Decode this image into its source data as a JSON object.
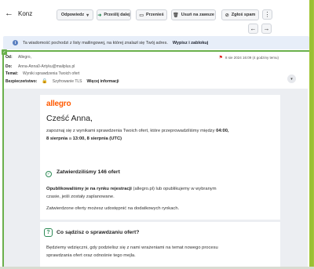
{
  "toolbar": {
    "back_label": "Konz",
    "reply_label": "Odpowiedz",
    "forward_label": "Prześlij dalej",
    "print_label": "Przenieś",
    "delete_label": "Usuń na zawsze",
    "report_label": "Zgłoś spam"
  },
  "notice": {
    "text": "Ta wiadomość pochodzi z listy mailingowej, na której znalazł się Twój adres.",
    "link": "Wypisz i zablokuj"
  },
  "header": {
    "from_key": "Od:",
    "from_val": "Allegro,",
    "to_key": "Do:",
    "to_val": "Anna-Anna0-Artyku@mailplus.pl",
    "subject_key": "Temat:",
    "subject_val": "Wyniki sprawdzenia Twoich ofert",
    "security_key": "Bezpieczeństwo:",
    "security_val": "Szyfrowanie TLS",
    "security_link": "Więcej informacji",
    "date": "8 sie 2024 16:09 (4 godziny temu)"
  },
  "email": {
    "logo": "allegro",
    "greeting": "Cześć Anna,",
    "intro_1": "zapoznaj się z wynikami sprawdzenia Twoich ofert, które przeprowadziliśmy między",
    "intro_time_1": "04:00,",
    "intro_date_1": "8 sierpnia",
    "intro_and": "a",
    "intro_time_2": "13:00, 8 sierpnia (UTC)",
    "sec1_title": "Zatwierdziliśmy 146 ofert",
    "sec1_p1_bold": "Opublikowaliśmy je na rynku rejestracji",
    "sec1_p1_rest": "(allegro.pl) lub opublikujemy w wybranym",
    "sec1_p1_line2": "czasie, jeśli zostały zaplanowane.",
    "sec1_p2": "Zatwierdzone oferty możesz udostępnić na dodatkowych rynkach.",
    "sec2_title": "Co sądzisz o sprawdzaniu ofert?",
    "sec2_p1": "Będziemy wdzięczni, gdy podzielisz się z nami wrażeniami na temat nowego procesu",
    "sec2_p2": "sprawdzania ofert oraz odnośnie tego mejla."
  },
  "colors": {
    "accent_green": "#6ab04c",
    "allegro_orange": "#ff5a00",
    "notice_bg": "#e7eef9"
  }
}
